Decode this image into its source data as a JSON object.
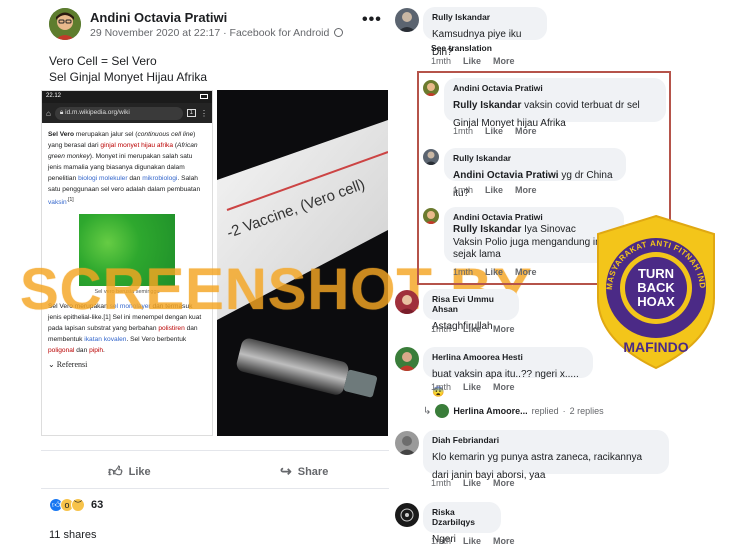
{
  "post": {
    "author": "Andini Octavia Pratiwi",
    "date": "29 November 2020 at 22:17",
    "via": "Facebook for Android",
    "line1": "Vero Cell = Sel Vero",
    "line2": "Sel Ginjal Monyet Hijau Afrika",
    "like_label": "Like",
    "share_label": "Share",
    "reaction_count": "63",
    "shares": "11 shares",
    "phone": {
      "time": "22.12",
      "url": "id.m.wikipedia.org/wiki",
      "tab_count": "1",
      "para1_bold": "Sel Vero",
      "para1_a": " merupakan jalur sel (",
      "para1_i1": "continuous cell line",
      "para1_b": ") yang berasal dari ",
      "para1_l1": "ginjal",
      "para1_l2": "monyet hijau afrika",
      "para1_c": " (",
      "para1_i2": "African green monkey",
      "para1_d": "). Monyet ini merupakan salah satu jenis mamalia yang biasanya digunakan dalam penelitian ",
      "para1_l3": "biologi molekuler",
      "para1_e": " dan ",
      "para1_l4": "mikrobiologi",
      "para1_f": ". Salah satu penggunaan sel vero adalah dalam pembuatan ",
      "para1_l5": "vaksin",
      "para1_g": ".[1]",
      "caption": "Sel vero berusia seminggu",
      "para2_a": "Sel Vero merupakan ",
      "para2_l1": "sel monolayer",
      "para2_b": " dan termasuk jenis epithelial-like.[1] Sel ini menempel dengan kuat pada lapisan substrat yang berbahan ",
      "para2_l2": "polistiren",
      "para2_c": " dan membentuk ",
      "para2_l3": "ikatan kovalen",
      "para2_d": ". Sel Vero berbentuk ",
      "para2_l4": "poligonal",
      "para2_e": " dan ",
      "para2_l5": "pipih",
      "para2_f": ".",
      "cut_heading": "Referensi"
    },
    "vial_label": "-2 Vaccine, (Vero cell)"
  },
  "watermark": "SCREENSHOT BY",
  "logo": {
    "ring_text": "MASYARAKAT ANTI FITNAH INDONESIA",
    "inner": [
      "TURN",
      "BACK",
      "HOAX"
    ],
    "bottom": "MAFINDO"
  },
  "comments": {
    "c1": {
      "name": "Rully Iskandar",
      "text": "Kamsudnya piye iku Din?",
      "translation": "See translation",
      "time": "1mth",
      "like": "Like",
      "more": "More"
    },
    "c2": {
      "name": "Andini Octavia Pratiwi",
      "tag": "Rully Iskandar",
      "text": " vaksin covid terbuat dr sel Ginjal Monyet hijau Afrika",
      "time": "1mth",
      "like": "Like",
      "more": "More"
    },
    "c3": {
      "name": "Rully Iskandar",
      "tag": "Andini Octavia Pratiwi",
      "text": " yg dr China itu?",
      "time": "1mth",
      "like": "Like",
      "more": "More"
    },
    "c4": {
      "name": "Andini Octavia Pratiwi",
      "tag": "Rully Iskandar",
      "text": " Iya Sinovac",
      "text2": "Vaksin Polio juga mengandung ini sejak lama",
      "time": "1mth",
      "like": "Like",
      "more": "More"
    },
    "c5": {
      "name": "Risa Evi Ummu Ahsan",
      "text": "Astaghfirullah",
      "time": "1mth",
      "like": "Like",
      "more": "More"
    },
    "c6": {
      "name": "Herlina Amoorea Hesti",
      "text": "buat vaksin apa itu..?? ngeri x.....",
      "emoji": "😨",
      "time": "1mth",
      "like": "Like",
      "more": "More"
    },
    "c6r": {
      "name": "Herlina Amoore...",
      "replied": "replied",
      "dot": "·",
      "replies": "2 replies"
    },
    "c7": {
      "name": "Diah Febriandari",
      "text": "Klo kemarin yg punya astra zaneca, racikannya dari janin bayi aborsi, yaa",
      "time": "1mth",
      "like": "Like",
      "more": "More"
    },
    "c8": {
      "name": "Riska Dzarbilqys",
      "text": "Ngeri",
      "time": "1mth",
      "like": "Like",
      "more": "More"
    }
  },
  "colors": {
    "watermark": "#f5a623",
    "highlight_box": "#b5534a",
    "link": "#3366cc",
    "red_link": "#ba0000",
    "logo_purple": "#4b2a86",
    "logo_gold": "#f3c51a"
  }
}
